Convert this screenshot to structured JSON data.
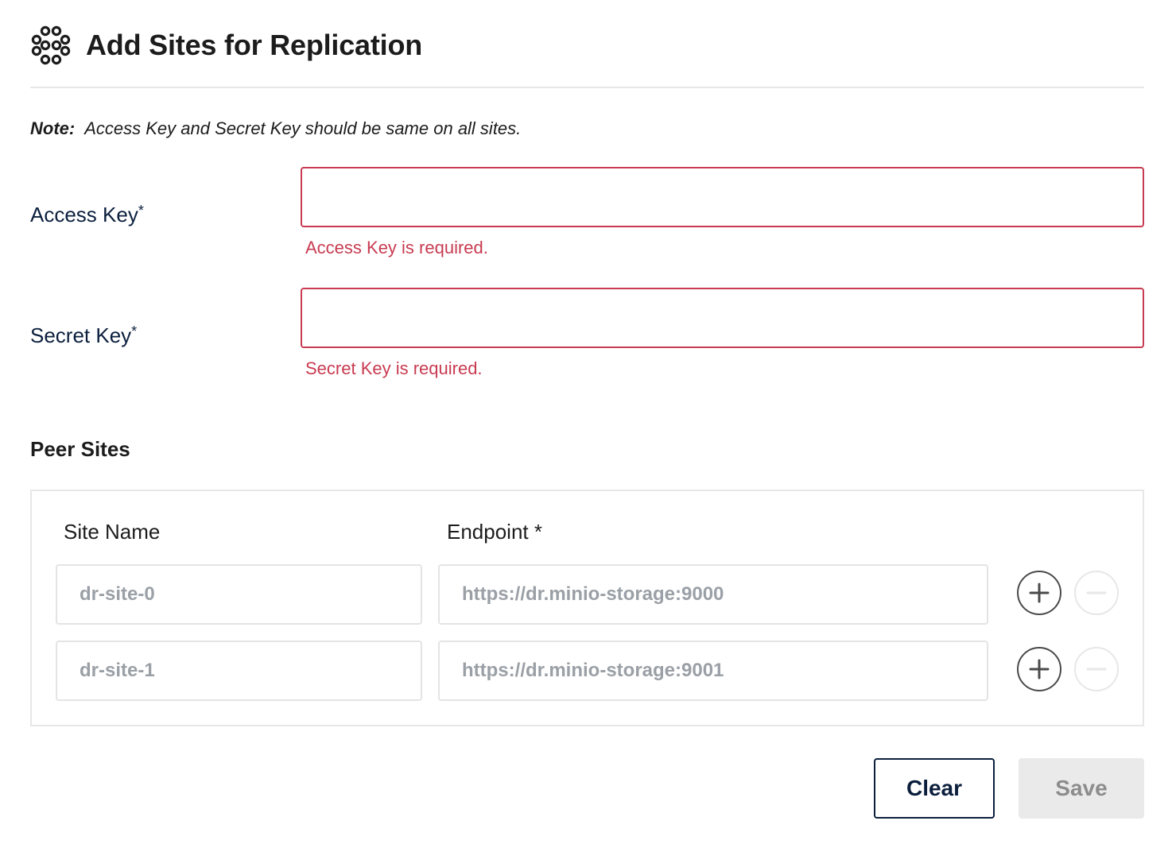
{
  "header": {
    "title": "Add Sites for Replication",
    "icon": "replication-icon"
  },
  "note": {
    "label": "Note:",
    "text": "Access Key and Secret Key should be same on all sites."
  },
  "access_key": {
    "label": "Access Key",
    "required_mark": "*",
    "value": "",
    "error": "Access Key is required."
  },
  "secret_key": {
    "label": "Secret Key",
    "required_mark": "*",
    "value": "",
    "error": "Secret Key is required."
  },
  "peer_sites": {
    "title": "Peer Sites",
    "columns": {
      "site_name": "Site Name",
      "endpoint": "Endpoint *"
    },
    "rows": [
      {
        "name_placeholder": "dr-site-0",
        "endpoint_placeholder": "https://dr.minio-storage:9000",
        "remove_enabled": false
      },
      {
        "name_placeholder": "dr-site-1",
        "endpoint_placeholder": "https://dr.minio-storage:9001",
        "remove_enabled": false
      }
    ]
  },
  "actions": {
    "clear_label": "Clear",
    "save_label": "Save",
    "save_enabled": false
  },
  "colors": {
    "error": "#c83b51",
    "primary_text": "#0b1f3d",
    "border": "#e7e7e7",
    "disabled_bg": "#eaeaea"
  }
}
